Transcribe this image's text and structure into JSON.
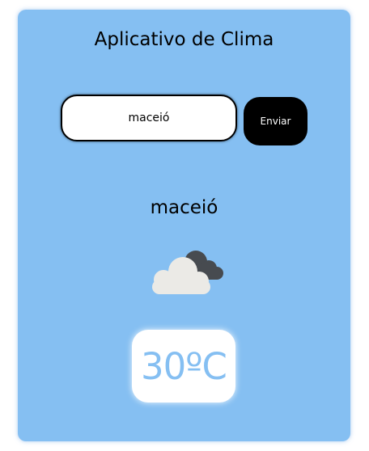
{
  "app": {
    "title": "Aplicativo de Clima"
  },
  "search": {
    "value": "maceió",
    "button_label": "Enviar"
  },
  "weather": {
    "city": "maceió",
    "icon": "cloudy-icon",
    "temperature": "30ºC"
  },
  "colors": {
    "card_background": "#85bff2",
    "temperature_text": "#85bff2",
    "button_background": "#000000"
  }
}
